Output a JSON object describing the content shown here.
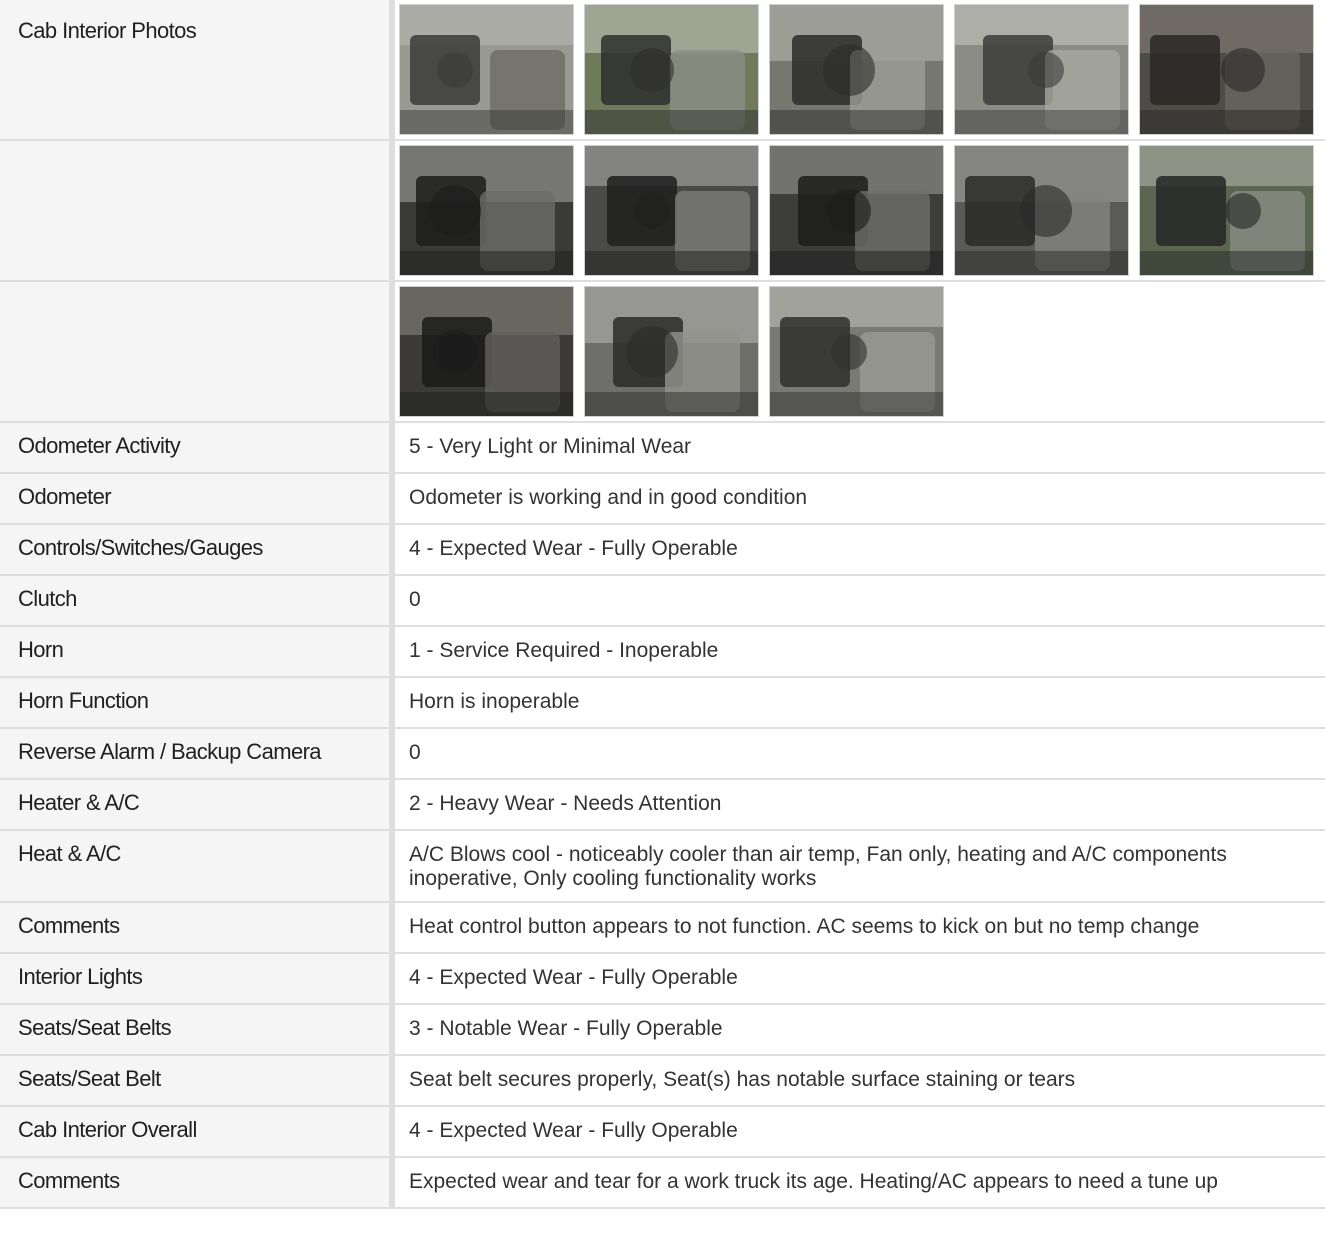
{
  "photos": {
    "label": "Cab Interior Photos",
    "rows": [
      [
        {
          "alt": "driver-door-open",
          "palette": [
            "#9a9a94",
            "#3a3a38",
            "#6b6b63",
            "#b9bab5"
          ]
        },
        {
          "alt": "door-panel",
          "palette": [
            "#6f7a5a",
            "#2e2f2e",
            "#8b8e86",
            "#c6c8c2"
          ]
        },
        {
          "alt": "dashboard-steering",
          "palette": [
            "#777772",
            "#2c2c2a",
            "#9d9d97",
            "#bdbdb7"
          ]
        },
        {
          "alt": "front-seats",
          "palette": [
            "#8c8c86",
            "#3b3b39",
            "#a7a7a1",
            "#c9cac5"
          ]
        },
        {
          "alt": "floor-mat",
          "palette": [
            "#4e4c47",
            "#2a2826",
            "#6a6660",
            "#8a847b"
          ]
        }
      ],
      [
        {
          "alt": "steering-wheel",
          "palette": [
            "#3a3a39",
            "#1d1d1c",
            "#6d6d6a",
            "#a8a8a4"
          ]
        },
        {
          "alt": "gauge-vent",
          "palette": [
            "#4a4a48",
            "#1f1f1e",
            "#7a7a77",
            "#b3b3b0"
          ]
        },
        {
          "alt": "radio-controls",
          "palette": [
            "#3d3d3c",
            "#1c1c1b",
            "#6e6e6b",
            "#9e9e9b"
          ]
        },
        {
          "alt": "glove-box",
          "palette": [
            "#5a5a58",
            "#2a2a29",
            "#838380",
            "#a9a9a6"
          ]
        },
        {
          "alt": "rear-door",
          "palette": [
            "#5b6651",
            "#262726",
            "#8a8d84",
            "#b7bab2"
          ]
        }
      ],
      [
        {
          "alt": "lower-dash",
          "palette": [
            "#3b3a38",
            "#1b1b1a",
            "#62605b",
            "#8d8a84"
          ]
        },
        {
          "alt": "rear-bench",
          "palette": [
            "#6e6e6a",
            "#2b2b2a",
            "#93938e",
            "#b8b8b3"
          ]
        },
        {
          "alt": "rear-view-cab",
          "palette": [
            "#7a7a75",
            "#2f2f2e",
            "#9b9b96",
            "#c2c2bd"
          ]
        }
      ]
    ]
  },
  "rows": [
    {
      "label": "Odometer Activity",
      "value": "5 - Very Light or Minimal Wear"
    },
    {
      "label": "Odometer",
      "value": "Odometer is working and in good condition"
    },
    {
      "label": "Controls/Switches/Gauges",
      "value": "4 - Expected Wear - Fully Operable"
    },
    {
      "label": "Clutch",
      "value": "0"
    },
    {
      "label": "Horn",
      "value": "1 - Service Required - Inoperable"
    },
    {
      "label": "Horn Function",
      "value": "Horn is inoperable"
    },
    {
      "label": "Reverse Alarm / Backup Camera",
      "value": "0"
    },
    {
      "label": "Heater & A/C",
      "value": "2 - Heavy Wear - Needs Attention"
    },
    {
      "label": "Heat & A/C",
      "value": "A/C Blows cool - noticeably cooler than air temp, Fan only, heating and A/C components inoperative, Only cooling functionality works"
    },
    {
      "label": "Comments",
      "value": "Heat control button appears to not function. AC seems to kick on but no temp change"
    },
    {
      "label": "Interior Lights",
      "value": "4 - Expected Wear - Fully Operable"
    },
    {
      "label": "Seats/Seat Belts",
      "value": "3 - Notable Wear - Fully Operable"
    },
    {
      "label": "Seats/Seat Belt",
      "value": "Seat belt secures properly, Seat(s) has notable surface staining or tears"
    },
    {
      "label": "Cab Interior Overall",
      "value": "4 - Expected Wear - Fully Operable"
    },
    {
      "label": "Comments",
      "value": "Expected wear and tear for a work truck its age. Heating/AC appears to need a tune up"
    }
  ]
}
